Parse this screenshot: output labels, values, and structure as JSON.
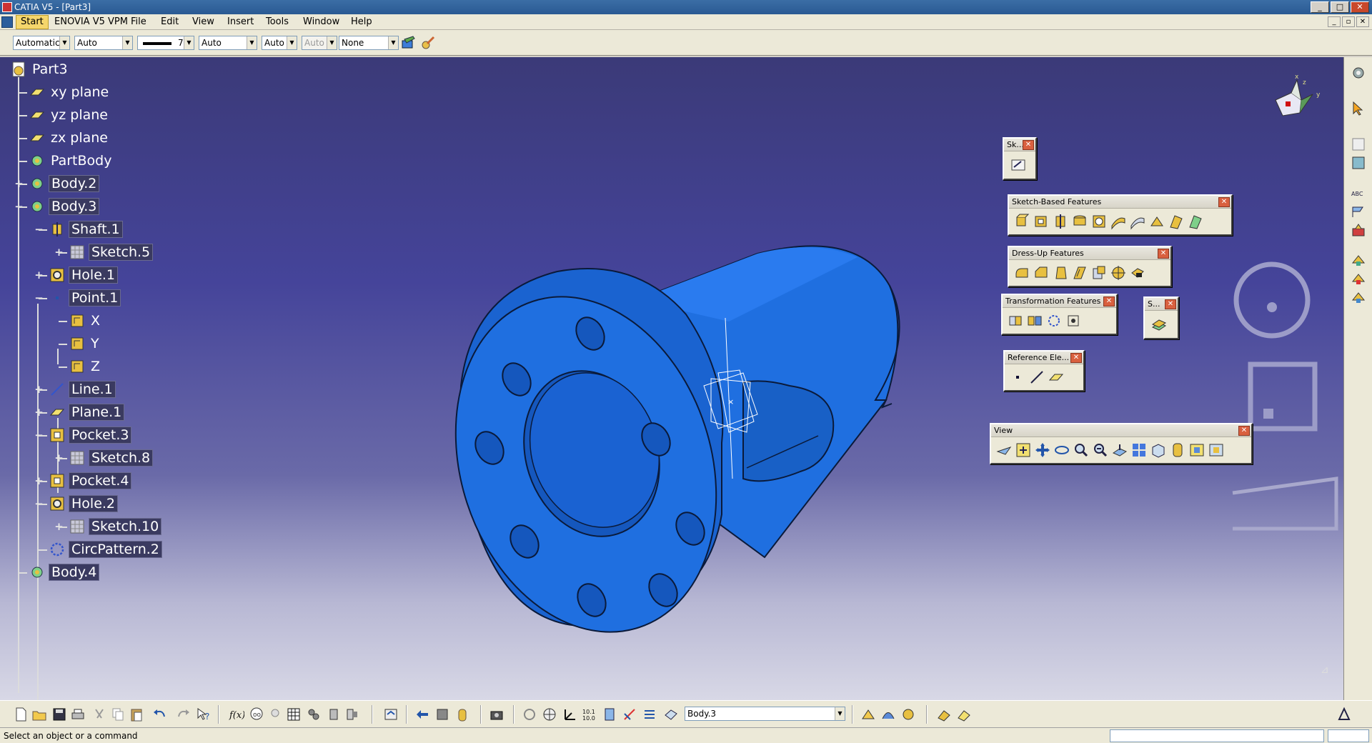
{
  "window": {
    "title": "CATIA V5 - [Part3]",
    "buttons": [
      "_",
      "□",
      "✕"
    ]
  },
  "menu": {
    "items": [
      "Start",
      "ENOVIA V5 VPM",
      "File",
      "Edit",
      "View",
      "Insert",
      "Tools",
      "Window",
      "Help"
    ]
  },
  "properties": {
    "color": "Automatic",
    "transparency": "Auto",
    "linetype_value": "7",
    "thickness": "Auto",
    "point_symbol": "Auto",
    "layer_disabled": "Auto",
    "layer": "None"
  },
  "tree": {
    "root": "Part3",
    "nodes": [
      {
        "label": "xy plane",
        "icon": "plane-icon"
      },
      {
        "label": "yz plane",
        "icon": "plane-icon"
      },
      {
        "label": "zx plane",
        "icon": "plane-icon"
      },
      {
        "label": "PartBody",
        "icon": "body-icon"
      },
      {
        "label": "Body.2",
        "icon": "body-icon"
      },
      {
        "label": "Body.3",
        "icon": "body-icon"
      },
      {
        "label": "Shaft.1",
        "icon": "shaft-icon"
      },
      {
        "label": "Sketch.5",
        "icon": "sketch-icon"
      },
      {
        "label": "Hole.1",
        "icon": "hole-icon"
      },
      {
        "label": "Point.1",
        "icon": "point-icon"
      },
      {
        "label": "X",
        "icon": "constraint-icon"
      },
      {
        "label": "Y",
        "icon": "constraint-icon"
      },
      {
        "label": "Z",
        "icon": "constraint-icon"
      },
      {
        "label": "Line.1",
        "icon": "line-icon"
      },
      {
        "label": "Plane.1",
        "icon": "plane-icon"
      },
      {
        "label": "Pocket.3",
        "icon": "pocket-icon"
      },
      {
        "label": "Sketch.8",
        "icon": "sketch-icon"
      },
      {
        "label": "Pocket.4",
        "icon": "pocket-icon"
      },
      {
        "label": "Hole.2",
        "icon": "hole-icon"
      },
      {
        "label": "Sketch.10",
        "icon": "sketch-icon"
      },
      {
        "label": "CircPattern.2",
        "icon": "circpattern-icon"
      },
      {
        "label": "Body.4",
        "icon": "body-icon"
      }
    ]
  },
  "toolbars": {
    "sketcher": "Sk...",
    "sketch_based": "Sketch-Based Features",
    "dress_up": "Dress-Up Features",
    "transformation": "Transformation Features",
    "s": "S...",
    "reference": "Reference Ele...",
    "view": "View"
  },
  "bottom": {
    "current_body": "Body.3"
  },
  "status": {
    "text": "Select an object or a command"
  },
  "colors": {
    "part_blue": "#1f6fe0",
    "part_edge": "#0a1a3a",
    "background_top": "#3b3a78"
  }
}
